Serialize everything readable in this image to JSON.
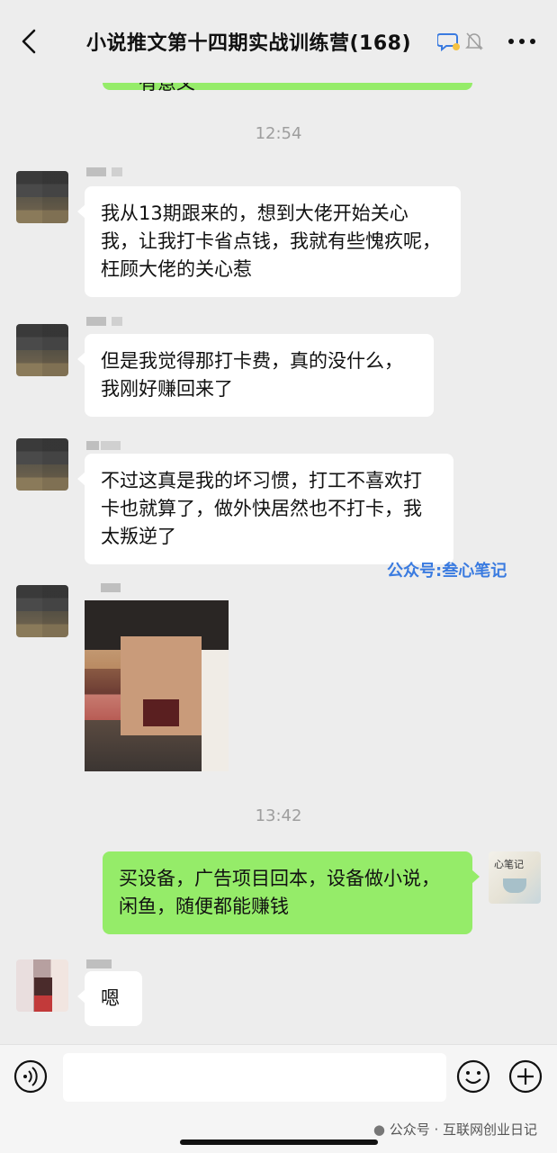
{
  "header": {
    "title": "小说推文第十四期实战训练营(168)",
    "icons": [
      "back-icon",
      "chat-bubble-icon",
      "mute-bell-icon",
      "more-icon"
    ]
  },
  "partial_message": {
    "text": "有意义"
  },
  "timestamps": {
    "t1": "12:54",
    "t2": "13:42"
  },
  "messages": [
    {
      "sender": "other",
      "text": "我从13期跟来的，想到大佬开始关心我，让我打卡省点钱，我就有些愧疚呢，枉顾大佬的关心惹"
    },
    {
      "sender": "other",
      "text": "但是我觉得那打卡费，真的没什么，我刚好赚回来了"
    },
    {
      "sender": "other",
      "text": "不过这真是我的坏习惯，打工不喜欢打卡也就算了，做外快居然也不打卡，我太叛逆了"
    },
    {
      "sender": "other",
      "type": "sticker"
    },
    {
      "sender": "me",
      "text": "买设备，广告项目回本，设备做小说，闲鱼，随便都能赚钱"
    },
    {
      "sender": "other",
      "text": "嗯"
    }
  ],
  "watermark": "公众号:叁心笔记",
  "footer_watermark": "公众号 · 互联网创业日记",
  "my_avatar_text": "心笔记",
  "colors": {
    "bg": "#ededed",
    "my_bubble": "#95ec69",
    "other_bubble": "#ffffff",
    "watermark": "#3a7be0"
  }
}
